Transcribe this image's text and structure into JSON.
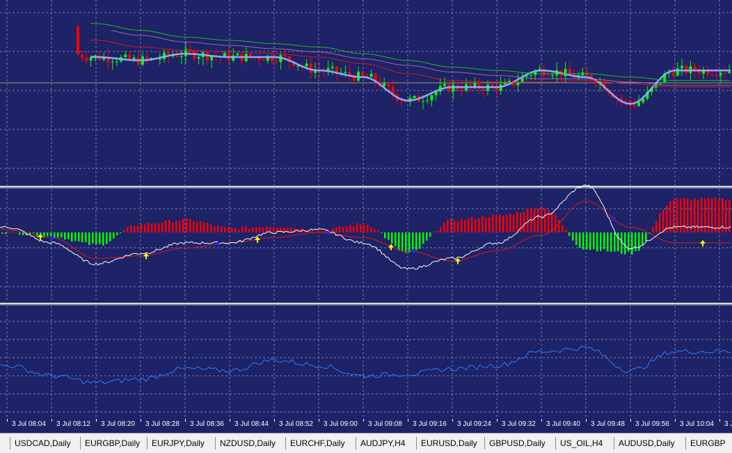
{
  "colors": {
    "background": "#1e2266",
    "grid": "#7a7fb0",
    "separator": "#d8d8d8",
    "bull": "#00ff00",
    "bear": "#ff0000",
    "ma_fast": "#8ea8ff",
    "ma_mid": "#cc1a1a",
    "ma_slow": "#22bb22",
    "ma_slower": "#9a6aa0",
    "signal_white": "#ffffff",
    "signal_red": "#e01818",
    "arrow_up": "#ffff00",
    "dot_blue": "#1a2aff",
    "rsi_line": "#2a7fff"
  },
  "time_axis": {
    "labels": [
      "3 Jul 08:04",
      "3 Jul 08:12",
      "3 Jul 08:20",
      "3 Jul 08:28",
      "3 Jul 08:36",
      "3 Jul 08:44",
      "3 Jul 08:52",
      "3 Jul 09:00",
      "3 Jul 09:08",
      "3 Jul 09:16",
      "3 Jul 09:24",
      "3 Jul 09:32",
      "3 Jul 09:40",
      "3 Jul 09:48",
      "3 Jul 09:56",
      "3 Jul 10:04",
      "3 J"
    ]
  },
  "tabs": [
    {
      "label": "USDCAD,Daily"
    },
    {
      "label": "EURGBP,Daily"
    },
    {
      "label": "EURJPY,Daily"
    },
    {
      "label": "NZDUSD,Daily"
    },
    {
      "label": "EURCHF,Daily"
    },
    {
      "label": "AUDJPY,H4"
    },
    {
      "label": "EURUSD,Daily"
    },
    {
      "label": "GBPUSD,Daily"
    },
    {
      "label": "US_OIL,H4"
    },
    {
      "label": "AUDUSD,Daily"
    },
    {
      "label": "EURGBP"
    }
  ],
  "chart_data": [
    {
      "type": "candlestick",
      "panel": "price",
      "x": [
        "3 Jul 08:04",
        "3 Jul 08:12",
        "3 Jul 08:20",
        "3 Jul 08:28",
        "3 Jul 08:36",
        "3 Jul 08:44",
        "3 Jul 08:52",
        "3 Jul 09:00",
        "3 Jul 09:08",
        "3 Jul 09:16",
        "3 Jul 09:24",
        "3 Jul 09:32",
        "3 Jul 09:40",
        "3 Jul 09:48",
        "3 Jul 09:56",
        "3 Jul 10:04"
      ],
      "series": [
        {
          "values": [
            0.88,
            0.74,
            0.7,
            0.68,
            0.72,
            0.7,
            0.7,
            0.62,
            0.58,
            0.44,
            0.52,
            0.52,
            0.62,
            0.58,
            0.42,
            0.62
          ]
        },
        {
          "values": [
            0.95,
            0.88,
            0.8,
            0.76,
            0.74,
            0.73,
            0.72,
            0.7,
            0.66,
            0.6,
            0.56,
            0.55,
            0.55,
            0.56,
            0.54,
            0.52
          ]
        },
        {
          "values": [
            1.02,
            0.96,
            0.9,
            0.86,
            0.82,
            0.8,
            0.78,
            0.76,
            0.72,
            0.68,
            0.64,
            0.62,
            0.6,
            0.6,
            0.58,
            0.56
          ]
        }
      ],
      "grid": true
    },
    {
      "type": "histogram",
      "panel": "oscillator",
      "x": [
        "3 Jul 08:04",
        "3 Jul 08:12",
        "3 Jul 08:20",
        "3 Jul 08:28",
        "3 Jul 08:36",
        "3 Jul 08:44",
        "3 Jul 08:52",
        "3 Jul 09:00",
        "3 Jul 09:08",
        "3 Jul 09:16",
        "3 Jul 09:24",
        "3 Jul 09:32",
        "3 Jul 09:40",
        "3 Jul 09:48",
        "3 Jul 09:56",
        "3 Jul 10:04"
      ],
      "series": [
        {
          "values": [
            0.0,
            -0.1,
            -0.3,
            0.2,
            0.3,
            0.1,
            0.15,
            0.05,
            0.2,
            -0.5,
            0.3,
            0.4,
            0.6,
            -0.4,
            -0.5,
            0.8
          ]
        },
        {
          "values": [
            0.1,
            -0.2,
            -0.6,
            -0.4,
            -0.2,
            -0.2,
            0.0,
            0.05,
            -0.2,
            -0.7,
            -0.5,
            -0.2,
            0.3,
            0.9,
            -0.3,
            0.1
          ]
        },
        {
          "values": [
            0.05,
            -0.1,
            -0.5,
            -0.45,
            -0.3,
            -0.2,
            -0.1,
            0.0,
            -0.1,
            -0.35,
            -0.55,
            -0.35,
            -0.05,
            0.6,
            0.1,
            -0.2
          ]
        }
      ],
      "grid": true
    },
    {
      "type": "line",
      "panel": "rsi",
      "x": [
        "3 Jul 08:04",
        "3 Jul 08:12",
        "3 Jul 08:20",
        "3 Jul 08:28",
        "3 Jul 08:36",
        "3 Jul 08:44",
        "3 Jul 08:52",
        "3 Jul 09:00",
        "3 Jul 09:08",
        "3 Jul 09:16",
        "3 Jul 09:24",
        "3 Jul 09:32",
        "3 Jul 09:40",
        "3 Jul 09:48",
        "3 Jul 09:56",
        "3 Jul 10:04"
      ],
      "series": [
        {
          "values": [
            50,
            44,
            40,
            42,
            48,
            47,
            53,
            50,
            44,
            45,
            48,
            50,
            58,
            60,
            47,
            58
          ]
        }
      ],
      "grid": true
    }
  ]
}
